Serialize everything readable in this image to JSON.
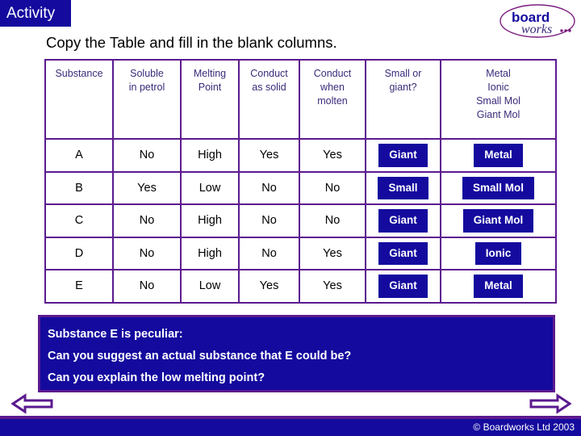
{
  "banner": {
    "label": "Activity"
  },
  "logo": {
    "word1": "board",
    "word2": "works"
  },
  "title": "Copy the Table and fill in the blank columns.",
  "table": {
    "headers": [
      {
        "lines": [
          "Substance"
        ]
      },
      {
        "lines": [
          "Soluble",
          "in petrol"
        ]
      },
      {
        "lines": [
          "Melting",
          "Point"
        ]
      },
      {
        "lines": [
          "Conduct",
          "as solid"
        ]
      },
      {
        "lines": [
          "Conduct",
          "when",
          "molten"
        ]
      },
      {
        "lines": [
          "Small or",
          "giant?"
        ]
      },
      {
        "lines": [
          "Metal",
          "Ionic",
          "Small Mol",
          "Giant Mol"
        ]
      }
    ],
    "rows": [
      {
        "substance": "A",
        "soluble_in_petrol": "No",
        "melting_point": "High",
        "conduct_as_solid": "Yes",
        "conduct_when_molten": "Yes",
        "small_or_giant": "Giant",
        "type": "Metal"
      },
      {
        "substance": "B",
        "soluble_in_petrol": "Yes",
        "melting_point": "Low",
        "conduct_as_solid": "No",
        "conduct_when_molten": "No",
        "small_or_giant": "Small",
        "type": "Small Mol"
      },
      {
        "substance": "C",
        "soluble_in_petrol": "No",
        "melting_point": "High",
        "conduct_as_solid": "No",
        "conduct_when_molten": "No",
        "small_or_giant": "Giant",
        "type": "Giant Mol"
      },
      {
        "substance": "D",
        "soluble_in_petrol": "No",
        "melting_point": "High",
        "conduct_as_solid": "No",
        "conduct_when_molten": "Yes",
        "small_or_giant": "Giant",
        "type": "Ionic"
      },
      {
        "substance": "E",
        "soluble_in_petrol": "No",
        "melting_point": "Low",
        "conduct_as_solid": "Yes",
        "conduct_when_molten": "Yes",
        "small_or_giant": "Giant",
        "type": "Metal"
      }
    ]
  },
  "questions": [
    "Substance E is peculiar:",
    "Can you suggest an actual substance that E could be?",
    "Can you explain the low melting point?"
  ],
  "footer": {
    "copyright": "© Boardworks Ltd 2003"
  },
  "colors": {
    "navy": "#140a9e",
    "purple": "#5b1a8f",
    "header_text": "#3b2a7a",
    "white": "#ffffff"
  }
}
